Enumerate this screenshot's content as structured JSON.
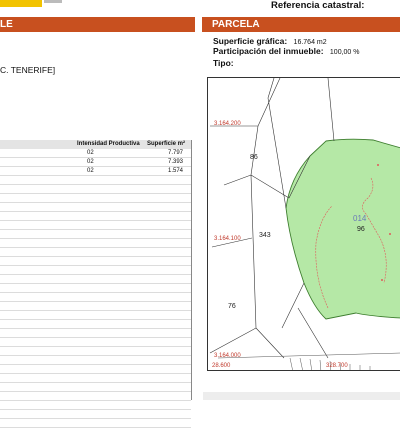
{
  "header": {
    "reference_label": "Referencia catastral:"
  },
  "sections": {
    "left_title": "LE",
    "right_title": "PARCELA"
  },
  "parcela": {
    "superficie_label": "Superficie gráfica:",
    "superficie_value": "16.764 m2",
    "participacion_label": "Participación del inmueble:",
    "participacion_value": "100,00 %",
    "tipo_label": "Tipo:"
  },
  "location": {
    "text": "C. TENERIFE]"
  },
  "cultivos": {
    "headers": [
      "Intensidad Productiva",
      "Superficie m²"
    ],
    "rows": [
      {
        "intensidad": "02",
        "superficie": "7.797"
      },
      {
        "intensidad": "02",
        "superficie": "7.393"
      },
      {
        "intensidad": "02",
        "superficie": "1.574"
      }
    ],
    "empty_rows": 28
  },
  "map": {
    "coord_labels": [
      "3.164.200",
      "3.164.100",
      "3.164.000",
      "28.600",
      "328.700"
    ],
    "parcel_labels": [
      "86",
      "343",
      "76",
      "96"
    ],
    "plot_label": "014",
    "colors": {
      "parcel_fill": "#b5e8a6",
      "parcel_stroke": "#3d7d2e",
      "subdivision": "#e05a5a",
      "grid_label": "#c0392b",
      "header_bg": "#c8501f"
    }
  }
}
